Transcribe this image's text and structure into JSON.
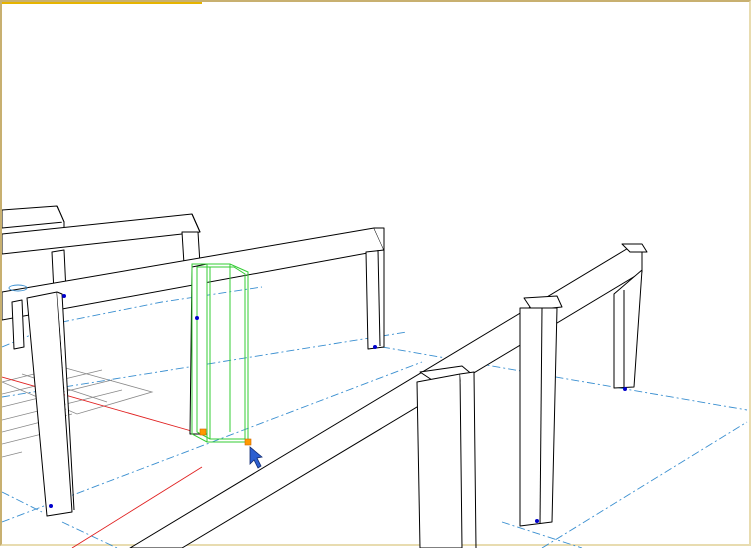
{
  "viewport": {
    "background": "#ffffff",
    "accent": "#e6b400",
    "line_color": "#000000",
    "grid_color": "#3a8fd0",
    "axis_color": "#e02020",
    "selection_color": "#33cc33",
    "snap_color": "#ff9900",
    "point_color": "#0000cc",
    "cursor_icon": "arrow-cursor-icon"
  }
}
